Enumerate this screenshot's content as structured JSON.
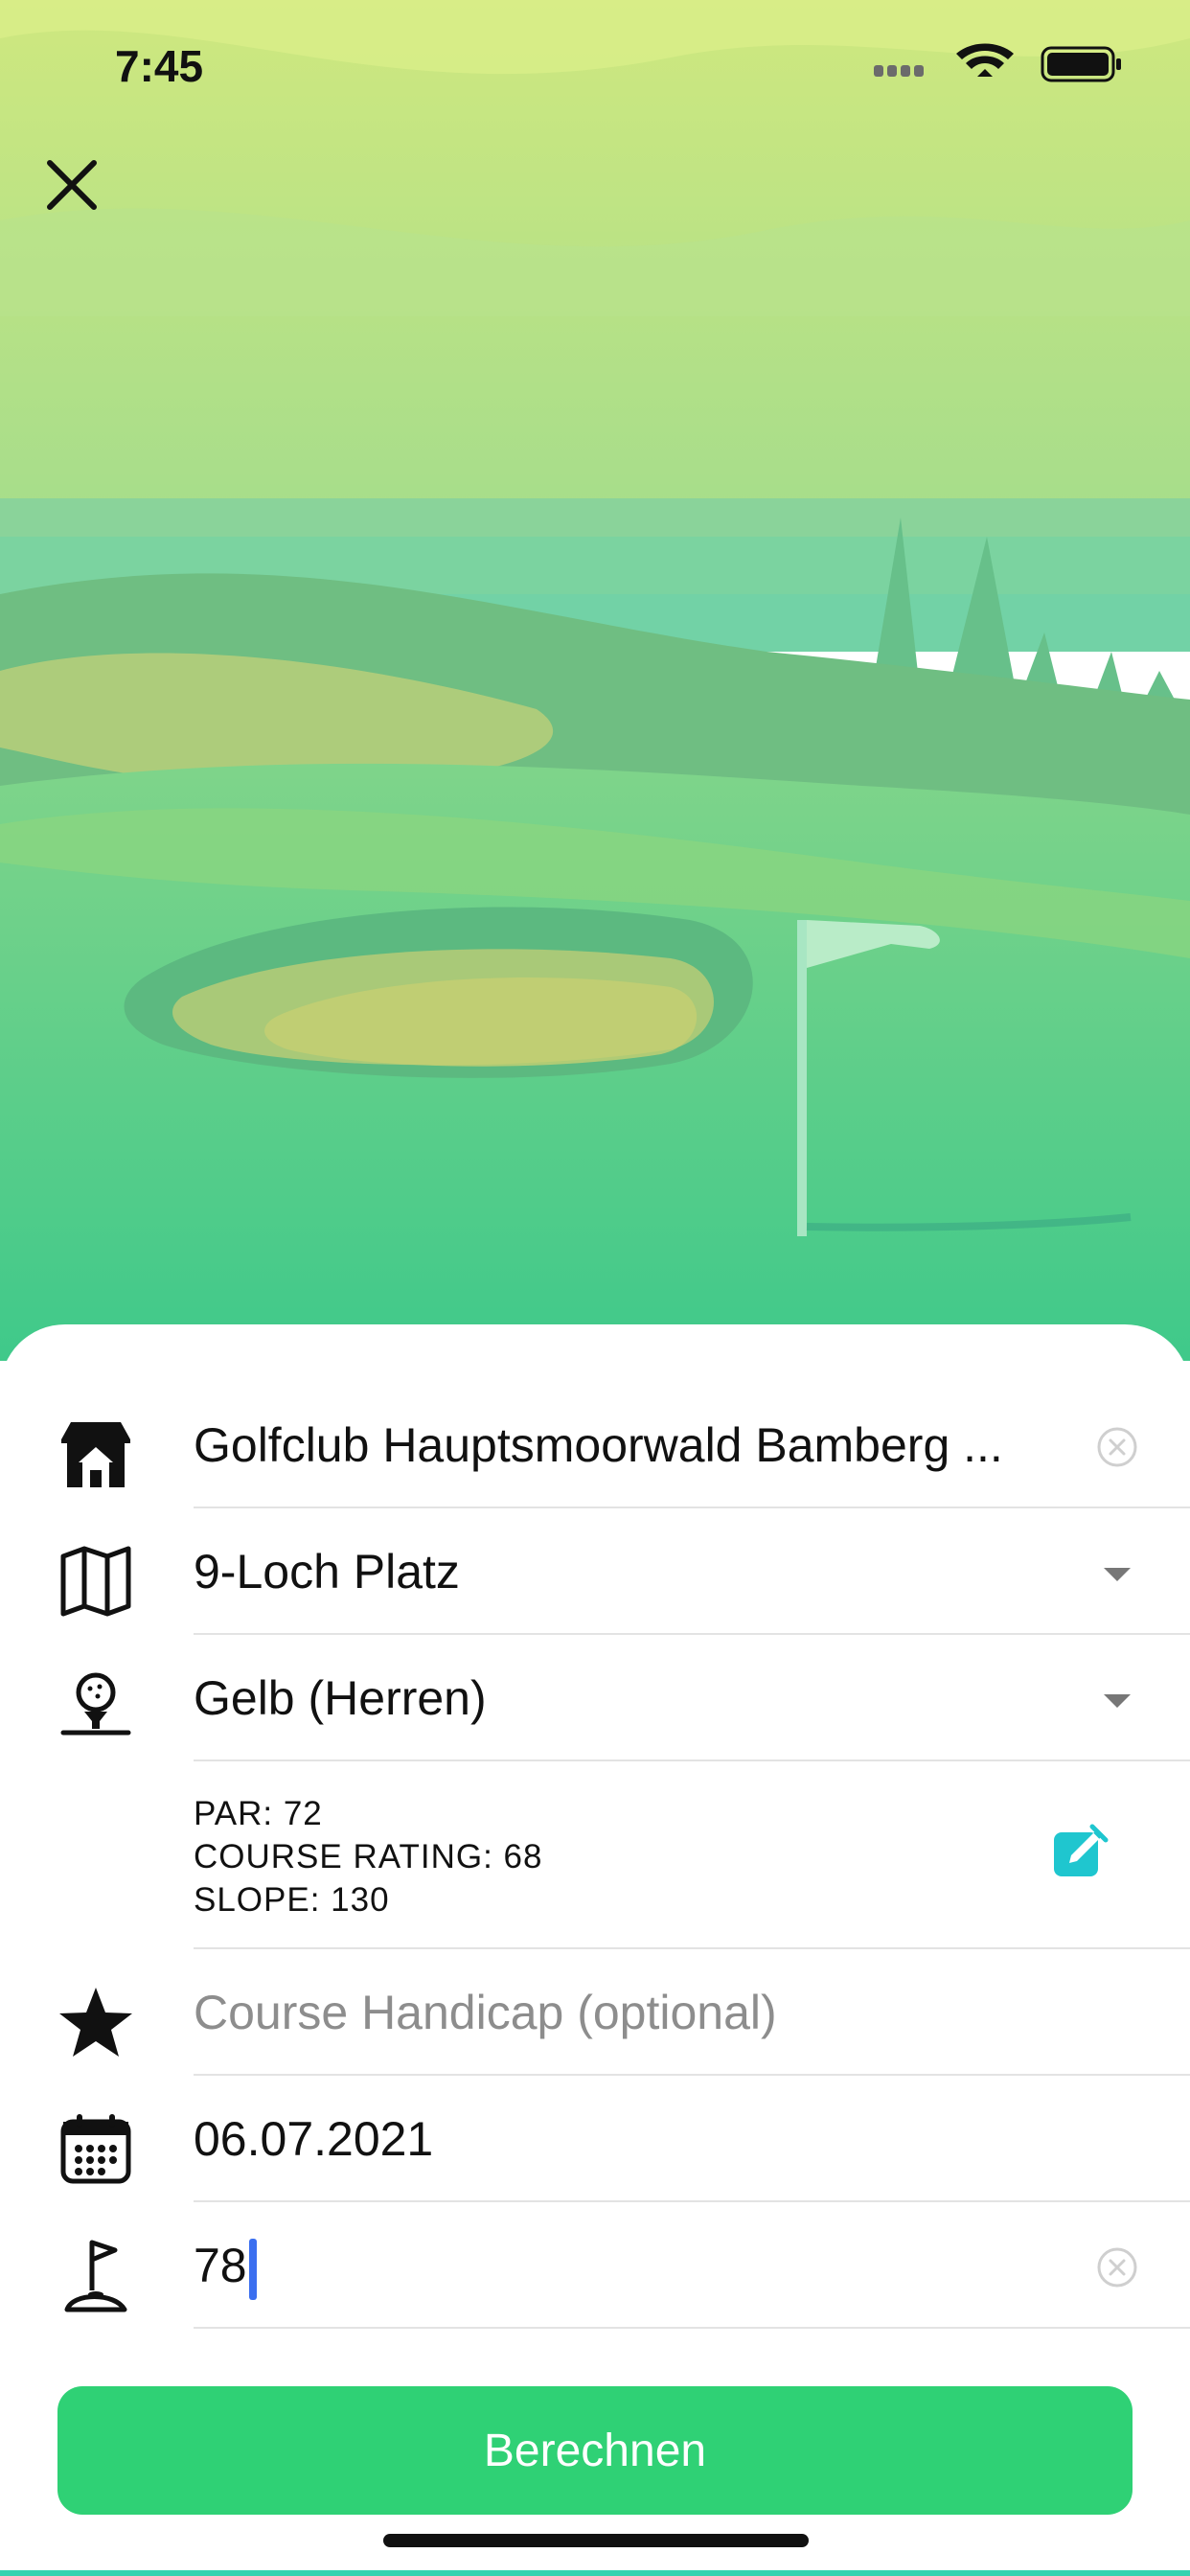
{
  "status_bar": {
    "time": "7:45"
  },
  "form": {
    "club": "Golfclub Hauptsmoorwald Bamberg ...",
    "course": "9-Loch Platz",
    "tee": "Gelb (Herren)",
    "info": {
      "par": "PAR: 72",
      "course_rating": "COURSE RATING: 68",
      "slope": "SLOPE: 130"
    },
    "handicap_placeholder": "Course Handicap (optional)",
    "date": "06.07.2021",
    "score": "78"
  },
  "actions": {
    "calculate_label": "Berechnen"
  },
  "icons": {
    "close": "close-icon",
    "club": "clubhouse-icon",
    "course": "map-icon",
    "tee": "golf-ball-tee-icon",
    "edit": "edit-icon",
    "handicap": "star-icon",
    "date": "calendar-icon",
    "score": "flag-icon",
    "clear": "clear-icon",
    "dropdown": "chevron-down-icon"
  },
  "colors": {
    "accent": "#2fd175",
    "edit": "#1fc6cf",
    "cursor": "#3b6ff0"
  }
}
